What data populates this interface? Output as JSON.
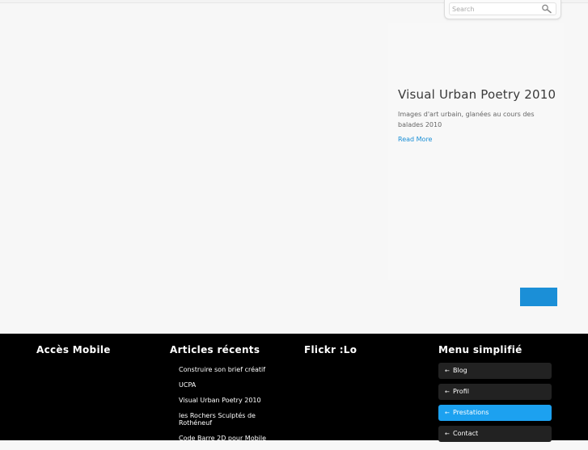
{
  "search": {
    "placeholder": "Search",
    "icon": "search-icon"
  },
  "feature": {
    "title": "Visual Urban Poetry 2010",
    "description": "Images d'art urbain, glanées au cours des balades 2010",
    "read_more": "Read More"
  },
  "footer": {
    "headings": {
      "mobile": "Accès Mobile",
      "recent": "Articles récents",
      "flickr": "Flickr :Lo",
      "menu": "Menu simplifié"
    },
    "recent_articles": [
      "Construire son brief créatif",
      "UCPA",
      "Visual Urban Poetry 2010",
      "les Rochers Sculptés de Rothéneuf",
      "Code Barre 2D pour Mobile"
    ],
    "menu_items": [
      {
        "label": "Blog",
        "active": false
      },
      {
        "label": "Profil",
        "active": false
      },
      {
        "label": "Prestations",
        "active": true
      },
      {
        "label": "Contact",
        "active": false
      }
    ]
  },
  "colors": {
    "accent": "#1b8fd7",
    "active_menu": "#1ca1f0",
    "footer_bg": "#000000",
    "menu_bg": "#222222"
  }
}
